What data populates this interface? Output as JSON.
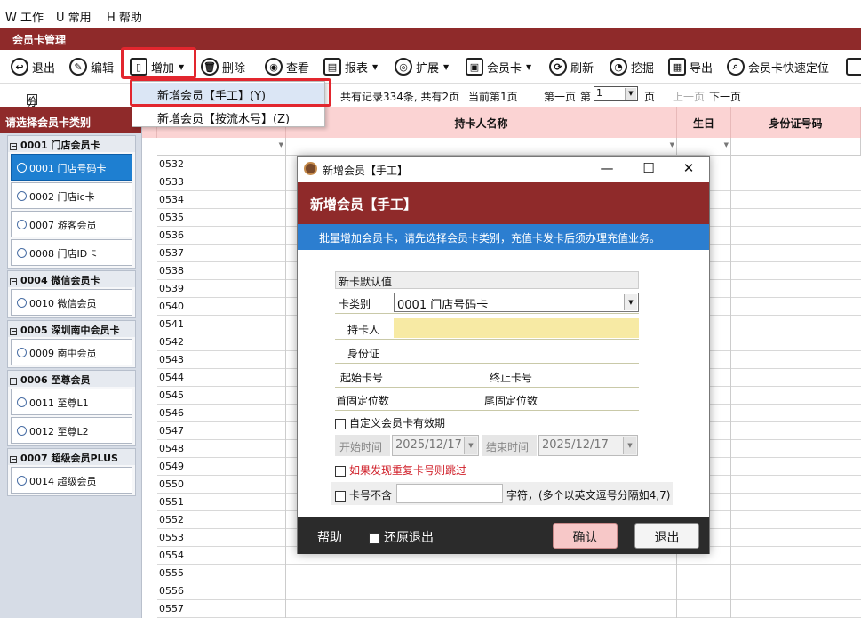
{
  "menubar": {
    "work": "W 工作",
    "common": "U 常用",
    "help": "H 帮助"
  },
  "window_title": "会员卡管理",
  "toolbar": {
    "exit": "退出",
    "edit": "编辑",
    "add": "增加",
    "delete": "删除",
    "view": "查看",
    "report": "报表",
    "expand": "扩展",
    "member_card": "会员卡",
    "refresh": "刷新",
    "dig": "挖掘",
    "export": "导出",
    "quick_locate": "会员卡快速定位"
  },
  "subbar": {
    "paging_label": "分页显示",
    "paging_checked": true,
    "records": "共有记录334条, 共有2页",
    "current_page": "当前第1页",
    "first_page": "第一页",
    "page_prefix": "第",
    "page_value": "1",
    "page_suffix": "页",
    "prev_page": "上一页",
    "next_page": "下一页"
  },
  "add_menu": {
    "manual": "新增会员【手工】(Y)",
    "serial": "新增会员【按流水号】(Z)"
  },
  "left_panel": {
    "header": "请选择会员卡类别",
    "groups": [
      {
        "title": "0001 门店会员卡",
        "items": [
          "0001 门店号码卡",
          "0002 门店ic卡",
          "0007 游客会员",
          "0008 门店ID卡"
        ]
      },
      {
        "title": "0004 微信会员卡",
        "items": [
          "0010 微信会员"
        ]
      },
      {
        "title": "0005 深圳南中会员卡",
        "items": [
          "0009 南中会员"
        ]
      },
      {
        "title": "0006 至尊会员",
        "items": [
          "0011 至尊L1",
          "0012 至尊L2"
        ]
      },
      {
        "title": "0007 超级会员PLUS",
        "items": [
          "0014 超级会员"
        ]
      }
    ]
  },
  "grid": {
    "columns": [
      "持卡人名称",
      "生日",
      "身份证号码"
    ],
    "rows": [
      "0532",
      "0533",
      "0534",
      "0535",
      "0536",
      "0537",
      "0538",
      "0539",
      "0540",
      "0541",
      "0542",
      "0543",
      "0544",
      "0545",
      "0546",
      "0547",
      "0548",
      "0549",
      "0550",
      "0551",
      "0552",
      "0553",
      "0554",
      "0555",
      "0556",
      "0557"
    ]
  },
  "dialog": {
    "title": "新增会员【手工】",
    "header": "新增会员【手工】",
    "info": "批量增加会员卡，请先选择会员卡类别，充值卡发卡后须办理充值业务。",
    "section": "新卡默认值",
    "card_type_label": "卡类别",
    "card_type_value": "0001 门店号码卡",
    "holder_label": "持卡人",
    "id_label": "身份证",
    "start_no_label": "起始卡号",
    "end_no_label": "终止卡号",
    "head_fixed_label": "首固定位数",
    "tail_fixed_label": "尾固定位数",
    "custom_validity_label": "自定义会员卡有效期",
    "start_time_label": "开始时间",
    "start_time_value": "2025/12/17",
    "end_time_label": "结束时间",
    "end_time_value": "2025/12/17",
    "skip_dup_label": "如果发现重复卡号则跳过",
    "exclude_label": "卡号不含",
    "exclude_hint": "字符，(多个以英文逗号分隔如4,7)",
    "help": "帮助",
    "restore_exit": "还原退出",
    "confirm": "确认",
    "cancel": "退出"
  }
}
